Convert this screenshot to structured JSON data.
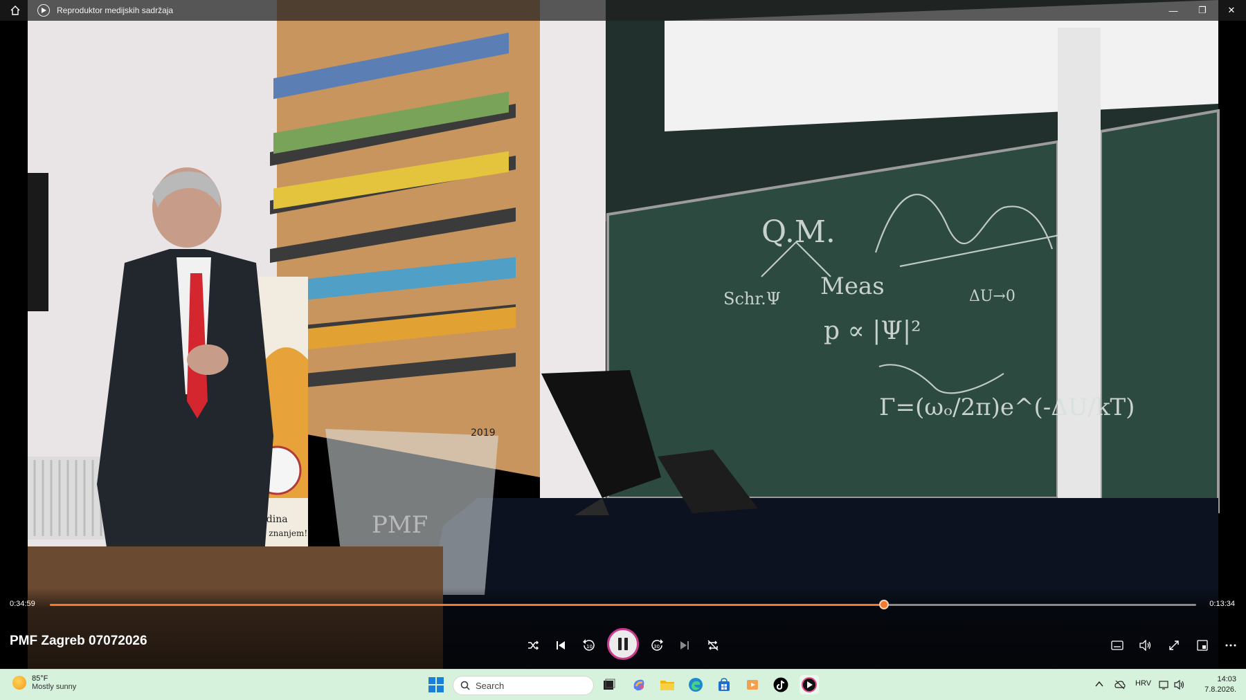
{
  "window": {
    "app_title": "Reproduktor medijskih sadržaja",
    "minimize_glyph": "—",
    "restore_glyph": "❐",
    "close_glyph": "✕"
  },
  "player": {
    "media_title": "PMF Zagreb 07072026",
    "elapsed": "0:34:59",
    "remaining": "0:13:34",
    "progress_fraction": 0.7276,
    "accent_color": "#f47a2a",
    "play_state": "playing"
  },
  "video_scene": {
    "board_text": [
      "Q.M.",
      "Meas",
      "p ∝ |Ψ|²",
      "ΔU→0",
      "Γ=(ωₒ/2π)e^(-ΔU/kT)",
      "Schr.Ψ"
    ],
    "banner_text": [
      "0 godina",
      "ruštvo znanjem!"
    ],
    "logo_text": "PMF",
    "year_text": "2019"
  },
  "taskbar": {
    "weather_temp": "85°F",
    "weather_condition": "Mostly sunny",
    "search_label": "Search",
    "language": "HRV",
    "time": "14:03",
    "date": "7.8.2026."
  }
}
